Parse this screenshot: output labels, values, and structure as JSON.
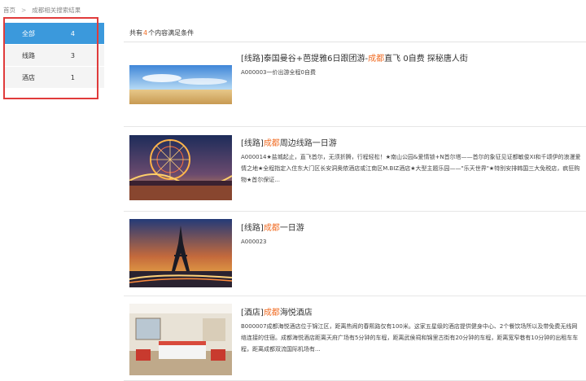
{
  "breadcrumb": {
    "home": "首页",
    "separator": ">",
    "current": "成都相关搜索结果"
  },
  "sidebar": {
    "items": [
      {
        "label": "全部",
        "count": "4",
        "active": true
      },
      {
        "label": "线路",
        "count": "3",
        "active": false
      },
      {
        "label": "酒店",
        "count": "1",
        "active": false
      }
    ]
  },
  "summary": {
    "prefix": "共有",
    "count": "4",
    "suffix": "个内容满足条件"
  },
  "results": [
    {
      "title_prefix": "[线路]泰国曼谷+芭提雅6日跟团游-",
      "keyword": "成都",
      "title_suffix": "直飞 0自费 探秘唐人街",
      "desc": "A000003一价出游全程0自费",
      "thumb_icon": "beach-image-icon"
    },
    {
      "title_prefix": "[线路]",
      "keyword": "成都",
      "title_suffix": "周边线路一日游",
      "desc": "A000014★盐城起止，直飞首尔，无须折腾，行程轻松！★南山公园&爱情锁+N首尔塔——首尔的象征见证都敏俊XI和千颂伊的浪漫爱情之地★全程指定入住东大门区长安洞奥侬酒店或江南区M.BIZ酒店★大型主题乐园——\"乐天世界\"★特别安排韩国三大免税店，疯狂购物★首尔保证...",
      "thumb_icon": "ferris-wheel-image-icon"
    },
    {
      "title_prefix": "[线路]",
      "keyword": "成都",
      "title_suffix": "一日游",
      "desc": "A000023",
      "thumb_icon": "eiffel-tower-image-icon"
    },
    {
      "title_prefix": "[酒店]",
      "keyword": "成都",
      "title_suffix": "海悦酒店",
      "desc": "B000007成都海悦酒店位于锦江区，距离热闹的春熙路仅有100米。这家五星级的酒店提供健身中心、2个餐饮场所以及带免费无线网络连接的住宿。成都海悦酒店距离天府广场有5分钟的车程，距离武侯祠和锦里古街有20分钟的车程，距离宽窄巷有10分钟的出租车车程，距离成都双流国际机场有...",
      "thumb_icon": "hotel-room-image-icon"
    }
  ],
  "colors": {
    "accent": "#3b99dc",
    "keyword": "#f06b22",
    "highlight_border": "#e03b3b"
  }
}
